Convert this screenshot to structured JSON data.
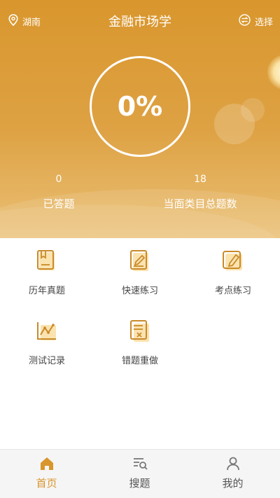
{
  "header": {
    "location": "湖南",
    "title": "金融市场学",
    "switch_label": "选择"
  },
  "progress": {
    "percent_text": "0%",
    "answered_count": "0",
    "answered_label": "已答题",
    "total_count": "18",
    "total_label": "当面类目总题数"
  },
  "menu": [
    {
      "label": "历年真题",
      "icon": "book-icon"
    },
    {
      "label": "快速练习",
      "icon": "edit-note-icon"
    },
    {
      "label": "考点练习",
      "icon": "pencil-pad-icon"
    },
    {
      "label": "测试记录",
      "icon": "chart-record-icon"
    },
    {
      "label": "错题重做",
      "icon": "wrong-list-icon"
    }
  ],
  "tabs": [
    {
      "label": "首页",
      "icon": "home-icon",
      "active": true
    },
    {
      "label": "搜题",
      "icon": "search-list-icon",
      "active": false
    },
    {
      "label": "我的",
      "icon": "user-icon",
      "active": false
    }
  ],
  "colors": {
    "accent": "#d9962d",
    "icon_fill": "#fbe3b0",
    "icon_stroke": "#c98a2a"
  }
}
